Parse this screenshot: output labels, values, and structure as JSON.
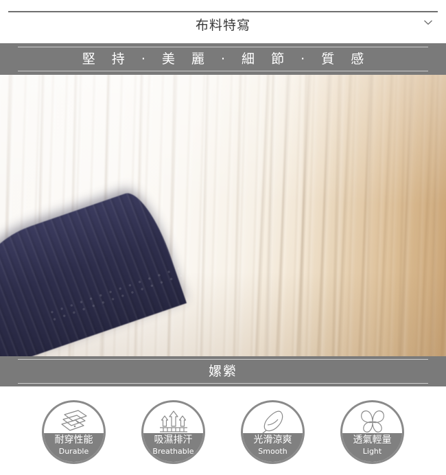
{
  "header": {
    "title": "布料特寫",
    "chevron_icon": "chevron-down-icon"
  },
  "slogan_banner": {
    "text": "堅 持  ·  美 麗  ·  細 節  ·  質 感",
    "background_color": "#7a7a7a",
    "text_color": "#ffffff"
  },
  "photo": {
    "alt": "白色羅紋布料特寫",
    "dominant_colors": [
      "#fbf9f6",
      "#ecdcc3",
      "#d5b68b",
      "#2e2e4c"
    ]
  },
  "material_banner": {
    "text": "嫘縈",
    "background_color": "#7a7a7a",
    "text_color": "#ffffff"
  },
  "features": [
    {
      "icon": "layered-sheets-icon",
      "label_zh": "耐穿性能",
      "label_en": "Durable"
    },
    {
      "icon": "up-arrows-icon",
      "label_zh": "吸濕排汗",
      "label_en": "Breathable"
    },
    {
      "icon": "feather-icon",
      "label_zh": "光滑涼爽",
      "label_en": "Smooth"
    },
    {
      "icon": "butterfly-icon",
      "label_zh": "透氣輕量",
      "label_en": "Light"
    }
  ],
  "theme": {
    "banner_gray": "#7a7a7a",
    "circle_gray": "#808080",
    "circle_border": "#8a8a8a",
    "rule_gray": "#6f6f6f"
  }
}
